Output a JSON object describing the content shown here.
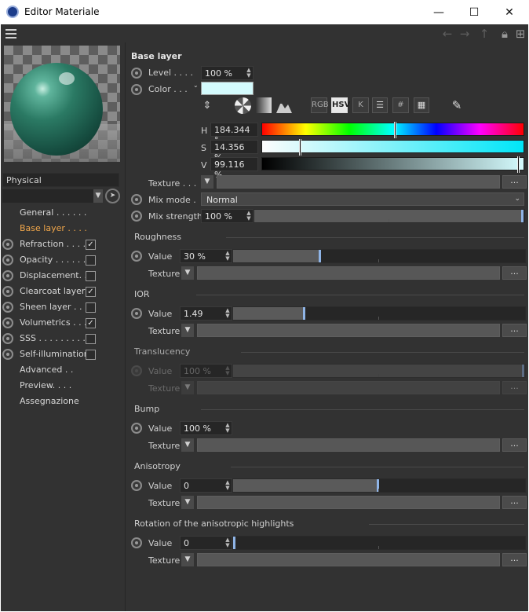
{
  "window": {
    "title": "Editor Materiale",
    "minimize": "—",
    "maximize": "☐",
    "close": "✕"
  },
  "preset": {
    "name": "Physical"
  },
  "nav": [
    {
      "label": "General . . . . . .",
      "radio": false,
      "check": null
    },
    {
      "label": "Base layer . . . .",
      "radio": false,
      "check": null,
      "active": true
    },
    {
      "label": "Refraction . . . .",
      "radio": true,
      "check": true
    },
    {
      "label": "Opacity . . . . . .",
      "radio": true,
      "check": false
    },
    {
      "label": "Displacement. . .",
      "radio": true,
      "check": false
    },
    {
      "label": "Clearcoat layer",
      "radio": true,
      "check": true
    },
    {
      "label": "Sheen layer . . . .",
      "radio": true,
      "check": false
    },
    {
      "label": "Volumetrics . . .",
      "radio": true,
      "check": true
    },
    {
      "label": "SSS . . . . . . . . .",
      "radio": true,
      "check": false
    },
    {
      "label": "Self-illumination",
      "radio": true,
      "check": false
    },
    {
      "label": "Advanced . .",
      "radio": false,
      "check": null
    },
    {
      "label": "Preview. . . .",
      "radio": false,
      "check": null
    },
    {
      "label": "Assegnazione",
      "radio": false,
      "check": null
    }
  ],
  "base": {
    "title": "Base layer",
    "level_label": "Level . . . .",
    "level_value": "100 %",
    "color_label": "Color . . .",
    "color_hex": "#d4fbfd",
    "modes": [
      "RGB",
      "HSV",
      "K",
      "#"
    ],
    "active_mode": "HSV",
    "h_label": "H",
    "h_value": "184.344 °",
    "h_fraction": 0.512,
    "s_label": "S",
    "s_value": "14.356 %",
    "s_fraction": 0.144,
    "v_label": "V",
    "v_value": "99.116 %",
    "v_fraction": 0.991,
    "texture_label": "Texture . . .",
    "mixmode_label": "Mix mode .",
    "mixmode_value": "Normal",
    "mixstrength_label": "Mix strength",
    "mixstrength_value": "100 %",
    "mixstrength_fraction": 1.0
  },
  "sections": [
    {
      "id": "roughness",
      "title": "Roughness",
      "value_label": "Value",
      "value": "30 %",
      "fraction": 0.3,
      "texture_label": "Texture",
      "dim": false
    },
    {
      "id": "ior",
      "title": "IOR",
      "value_label": "Value",
      "value": "1.49",
      "fraction": 0.245,
      "texture_label": "Texture",
      "dim": false
    },
    {
      "id": "translucency",
      "title": "Translucency",
      "value_label": "Value",
      "value": "100 %",
      "fraction": 1.0,
      "texture_label": "Texture",
      "dim": true
    },
    {
      "id": "bump",
      "title": "Bump",
      "value_label": "Value",
      "value": "100 %",
      "fraction": null,
      "texture_label": "Texture",
      "dim": false
    },
    {
      "id": "anisotropy",
      "title": "Anisotropy",
      "value_label": "Value",
      "value": "0",
      "fraction": 0.5,
      "texture_label": "Texture",
      "dim": false
    },
    {
      "id": "rotation",
      "title": "Rotation of the anisotropic highlights",
      "value_label": "Value",
      "value": "0",
      "fraction": 0.0,
      "texture_label": "Texture",
      "dim": false
    }
  ],
  "ellipsis": "...",
  "icons": [
    "menu-icon",
    "back-arrow-icon",
    "forward-arrow-icon",
    "up-arrow-icon",
    "lock-icon",
    "new-window-icon",
    "eyedropper-icon",
    "color-wheel-icon",
    "spectrum-icon",
    "picture-icon",
    "palette-icon",
    "mixer-icon"
  ]
}
